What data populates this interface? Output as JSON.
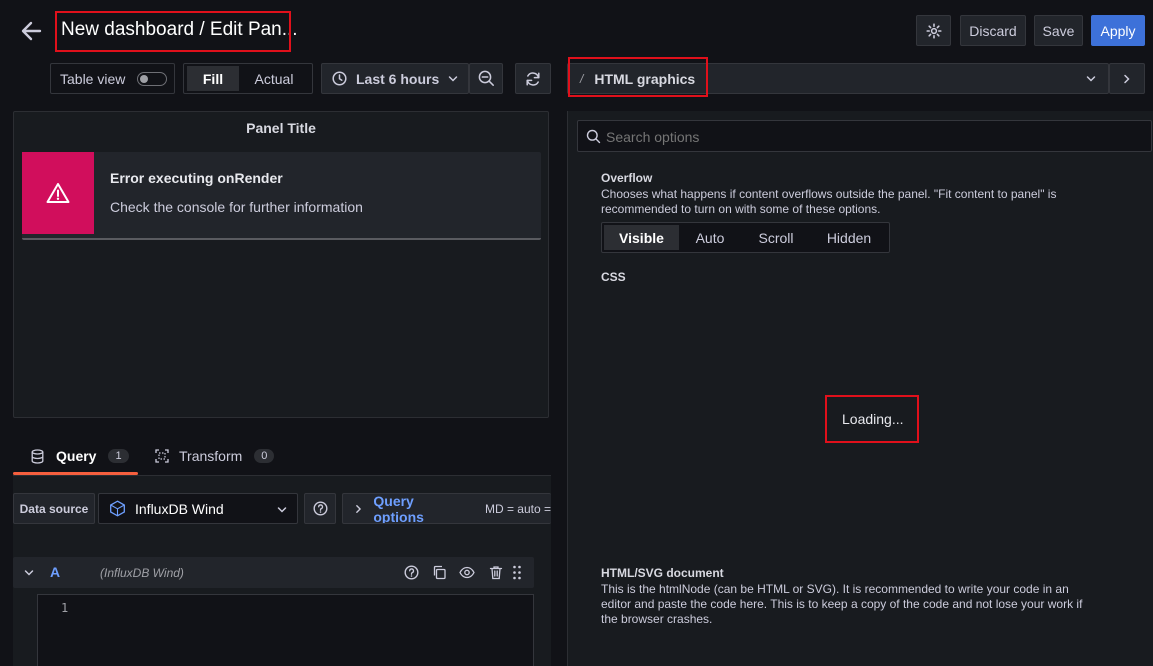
{
  "header": {
    "title": "New dashboard / Edit Pan...",
    "discard_label": "Discard",
    "save_label": "Save",
    "apply_label": "Apply"
  },
  "toolbar": {
    "table_view_label": "Table view",
    "table_view_on": false,
    "fill_label": "Fill",
    "actual_label": "Actual",
    "time_range_label": "Last 6 hours",
    "visualization_label": "HTML graphics"
  },
  "panel": {
    "title": "Panel Title",
    "error_title": "Error executing onRender",
    "error_text": "Check the console for further information"
  },
  "query_tabs": [
    {
      "label": "Query",
      "count": "1"
    },
    {
      "label": "Transform",
      "count": "0"
    }
  ],
  "query_bar": {
    "datasource_label": "Data source",
    "datasource_value": "InfluxDB Wind",
    "query_options_label": "Query options",
    "query_options_summary": "MD = auto ="
  },
  "query_row": {
    "ref_id": "A",
    "datasource": "(InfluxDB Wind)",
    "line_number": "1"
  },
  "options": {
    "search_placeholder": "Search options",
    "overflow": {
      "title": "Overflow",
      "description": "Chooses what happens if content overflows outside the panel. \"Fit content to panel\" is recommended to turn on with some of these options.",
      "choices": [
        "Visible",
        "Auto",
        "Scroll",
        "Hidden"
      ],
      "selected": "Visible"
    },
    "css": {
      "title": "CSS",
      "loading_text": "Loading..."
    },
    "html_doc": {
      "title": "HTML/SVG document",
      "description": "This is the htmlNode (can be HTML or SVG). It is recommended to write your code in an editor and paste the code here. This is to keep a copy of the code and not lose your work if the browser crashes."
    }
  },
  "colors": {
    "accent": "#3d71d9",
    "error": "#d10e5c",
    "tab_underline": "#f55f3e",
    "link": "#6e9fff"
  }
}
